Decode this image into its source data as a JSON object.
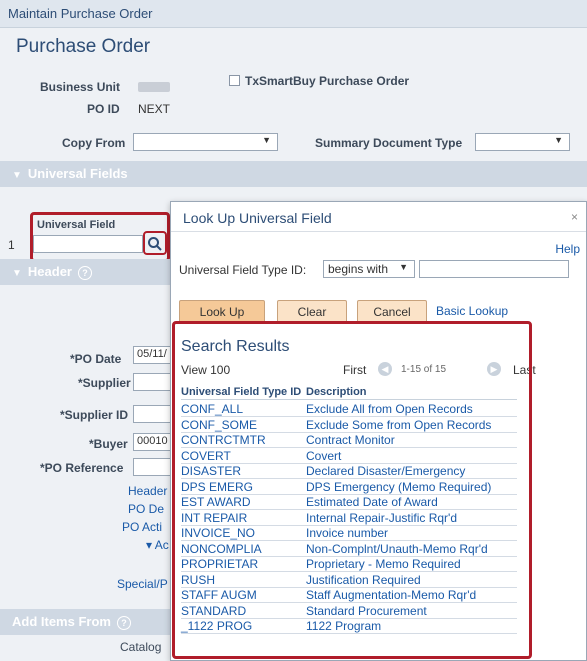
{
  "page": {
    "app_title": "Maintain Purchase Order",
    "title": "Purchase Order",
    "business_unit_label": "Business Unit",
    "txsmartbuy_label": "TxSmartBuy Purchase Order",
    "po_id_label": "PO ID",
    "po_id_value": "NEXT",
    "copy_from_label": "Copy From",
    "summary_doc_type_label": "Summary Document Type"
  },
  "universal_fields": {
    "section_title": "Universal Fields",
    "column_label": "Universal Field",
    "row_number": "1"
  },
  "header": {
    "section_title": "Header",
    "po_date_label": "*PO Date",
    "po_date_value": "05/11/",
    "supplier_label": "*Supplier",
    "supplier_id_label": "*Supplier ID",
    "buyer_label": "*Buyer",
    "buyer_value": "00010",
    "po_reference_label": "*PO Reference",
    "links": [
      "Header",
      "PO De",
      "PO Acti",
      "▾ Ac"
    ],
    "special_label": "Special/P"
  },
  "add_items": {
    "section_title": "Add Items From",
    "catalog_label": "Catalog"
  },
  "modal": {
    "title": "Look Up Universal Field",
    "close": "×",
    "help": "Help",
    "field_label": "Universal Field Type ID:",
    "operator": "begins with",
    "buttons": {
      "lookup": "Look Up",
      "clear": "Clear",
      "cancel": "Cancel",
      "basic_lookup": "Basic Lookup"
    },
    "results_title": "Search Results",
    "view_label": "View 100",
    "first_label": "First",
    "range_label": "1-15 of 15",
    "last_label": "Last",
    "columns": [
      "Universal Field Type ID",
      "Description"
    ],
    "rows": [
      [
        "CONF_ALL",
        "Exclude All from Open Records"
      ],
      [
        "CONF_SOME",
        "Exclude Some from Open Records"
      ],
      [
        "CONTRCTMTR",
        "Contract Monitor"
      ],
      [
        "COVERT",
        "Covert"
      ],
      [
        "DISASTER",
        "Declared Disaster/Emergency"
      ],
      [
        "DPS EMERG",
        "DPS Emergency (Memo Required)"
      ],
      [
        "EST AWARD",
        "Estimated Date of Award"
      ],
      [
        "INT REPAIR",
        "Internal Repair-Justific Rqr'd"
      ],
      [
        "INVOICE_NO",
        "Invoice number"
      ],
      [
        "NONCOMPLIA",
        "Non-Complnt/Unauth-Memo Rqr'd"
      ],
      [
        "PROPRIETAR",
        "Proprietary - Memo Required"
      ],
      [
        "RUSH",
        "Justification Required"
      ],
      [
        "STAFF AUGM",
        "Staff Augmentation-Memo Rqr'd"
      ],
      [
        "STANDARD",
        "Standard Procurement"
      ],
      [
        "_1122 PROG",
        "1122 Program"
      ]
    ]
  },
  "colors": {
    "accent": "#2d4d76",
    "link": "#1a5aa8",
    "highlight": "#b01d2a",
    "button": "#f5c998"
  }
}
